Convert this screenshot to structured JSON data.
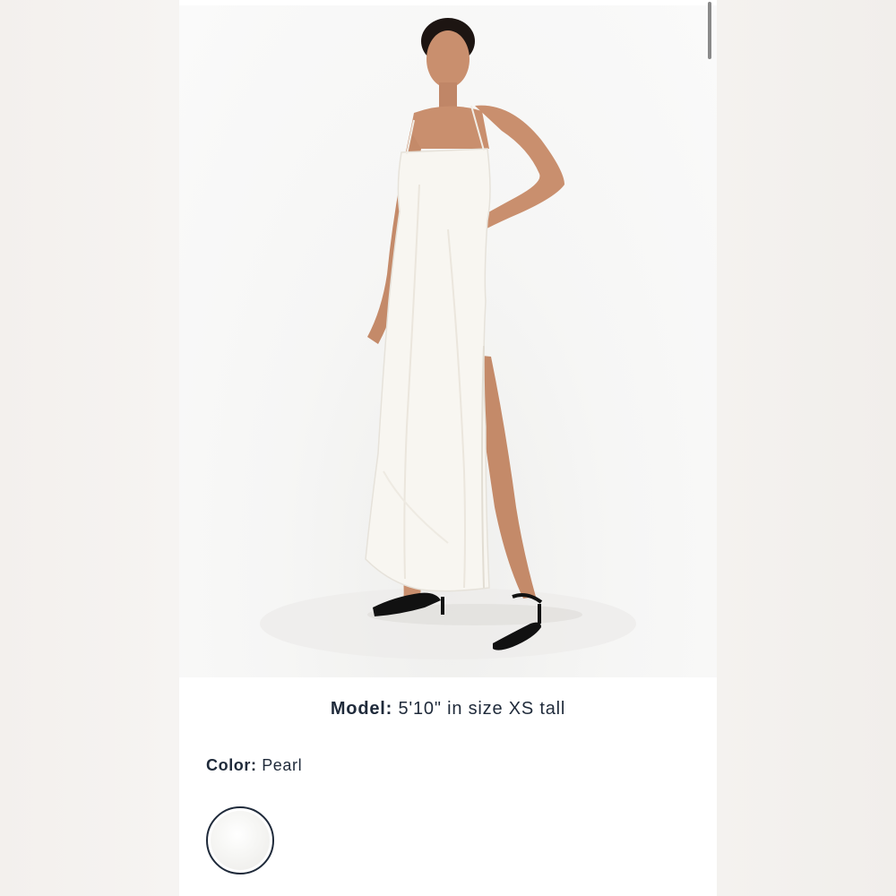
{
  "product": {
    "image_alt": "model wearing white dress",
    "model_label": "Model:",
    "model_value": "5'10\" in size XS tall",
    "color_label": "Color:",
    "color_value": "Pearl",
    "swatch_name": "Pearl"
  },
  "colors": {
    "text": "#1f2a3a",
    "dress": "#f8f6f1",
    "skin": "#c98f6e",
    "shoes": "#111111"
  }
}
